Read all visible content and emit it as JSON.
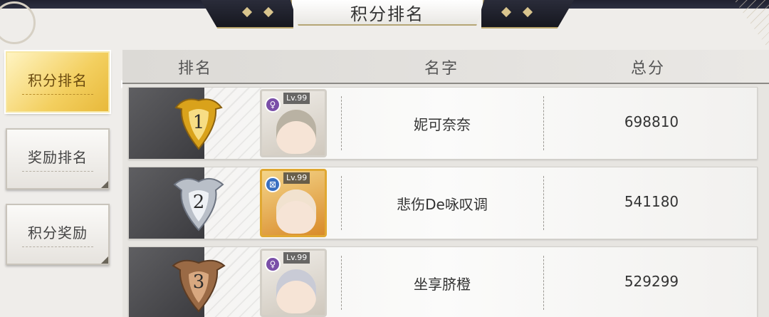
{
  "title": "积分排名",
  "sidebar": {
    "items": [
      {
        "label": "积分排名",
        "active": true
      },
      {
        "label": "奖励排名",
        "active": false
      },
      {
        "label": "积分奖励",
        "active": false
      }
    ]
  },
  "table": {
    "headers": {
      "rank": "排名",
      "name": "名字",
      "score": "总分"
    },
    "rows": [
      {
        "rank": "1",
        "level": "Lv.99",
        "element_icon": "venus-icon",
        "name": "妮可奈奈",
        "score": "698810",
        "badge_color": "#d9a21b"
      },
      {
        "rank": "2",
        "level": "Lv.99",
        "element_icon": "crossed-box-icon",
        "name": "悲伤De咏叹调",
        "score": "541180",
        "badge_color": "#b9bfc8"
      },
      {
        "rank": "3",
        "level": "Lv.99",
        "element_icon": "venus-icon",
        "name": "坐享脐橙",
        "score": "529299",
        "badge_color": "#9a6a45"
      }
    ]
  },
  "colors": {
    "active_tab": "#f3cf5f",
    "gold_border": "#b6a676"
  }
}
